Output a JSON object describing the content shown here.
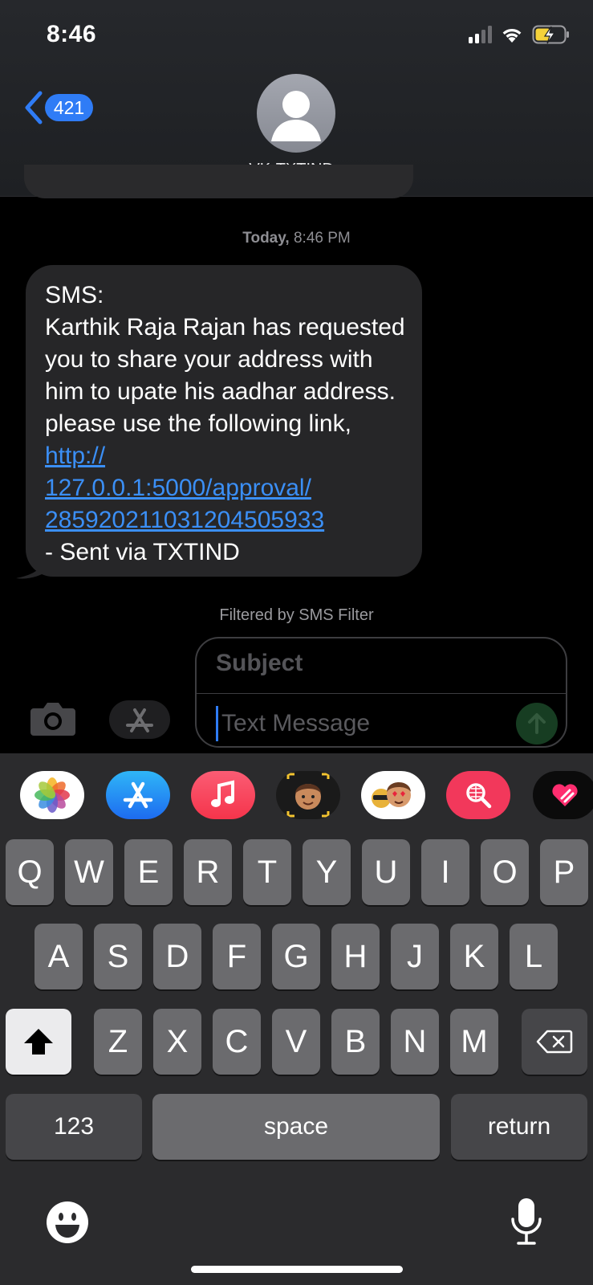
{
  "status_bar": {
    "time": "8:46",
    "icons": [
      "cellular-signal-icon",
      "wifi-icon",
      "battery-charging-icon"
    ]
  },
  "header": {
    "back_count": "421",
    "contact_name": "VK-TXTIND",
    "chevron": "›"
  },
  "conversation": {
    "timestamp_day": "Today,",
    "timestamp_time": "8:46 PM",
    "message": {
      "intro": "SMS:",
      "body": "Karthik Raja Rajan has requested you to share your address with him to upate his aadhar address. please use the following link, ",
      "link_part1": "http://",
      "link_part2": "127.0.0.1:5000/approval/",
      "link_part3": "285920211031204505933",
      "footer": "- Sent via TXTIND"
    },
    "filter_note": "Filtered by SMS Filter"
  },
  "compose": {
    "subject_placeholder": "Subject",
    "message_placeholder": "Text Message"
  },
  "app_strip": [
    "photos-icon",
    "app-store-icon",
    "music-icon",
    "memoji-icon",
    "memoji-stickers-icon",
    "image-search-icon",
    "digital-touch-icon"
  ],
  "keyboard": {
    "row1": [
      "Q",
      "W",
      "E",
      "R",
      "T",
      "Y",
      "U",
      "I",
      "O",
      "P"
    ],
    "row2": [
      "A",
      "S",
      "D",
      "F",
      "G",
      "H",
      "J",
      "K",
      "L"
    ],
    "row3": [
      "Z",
      "X",
      "C",
      "V",
      "B",
      "N",
      "M"
    ],
    "numbers_key": "123",
    "space_key": "space",
    "return_key": "return"
  },
  "colors": {
    "accent": "#2f7cf6",
    "link": "#3b8ff6",
    "bubble": "#262628",
    "keyboard_bg": "#2b2b2d",
    "key": "#6b6b6e"
  }
}
